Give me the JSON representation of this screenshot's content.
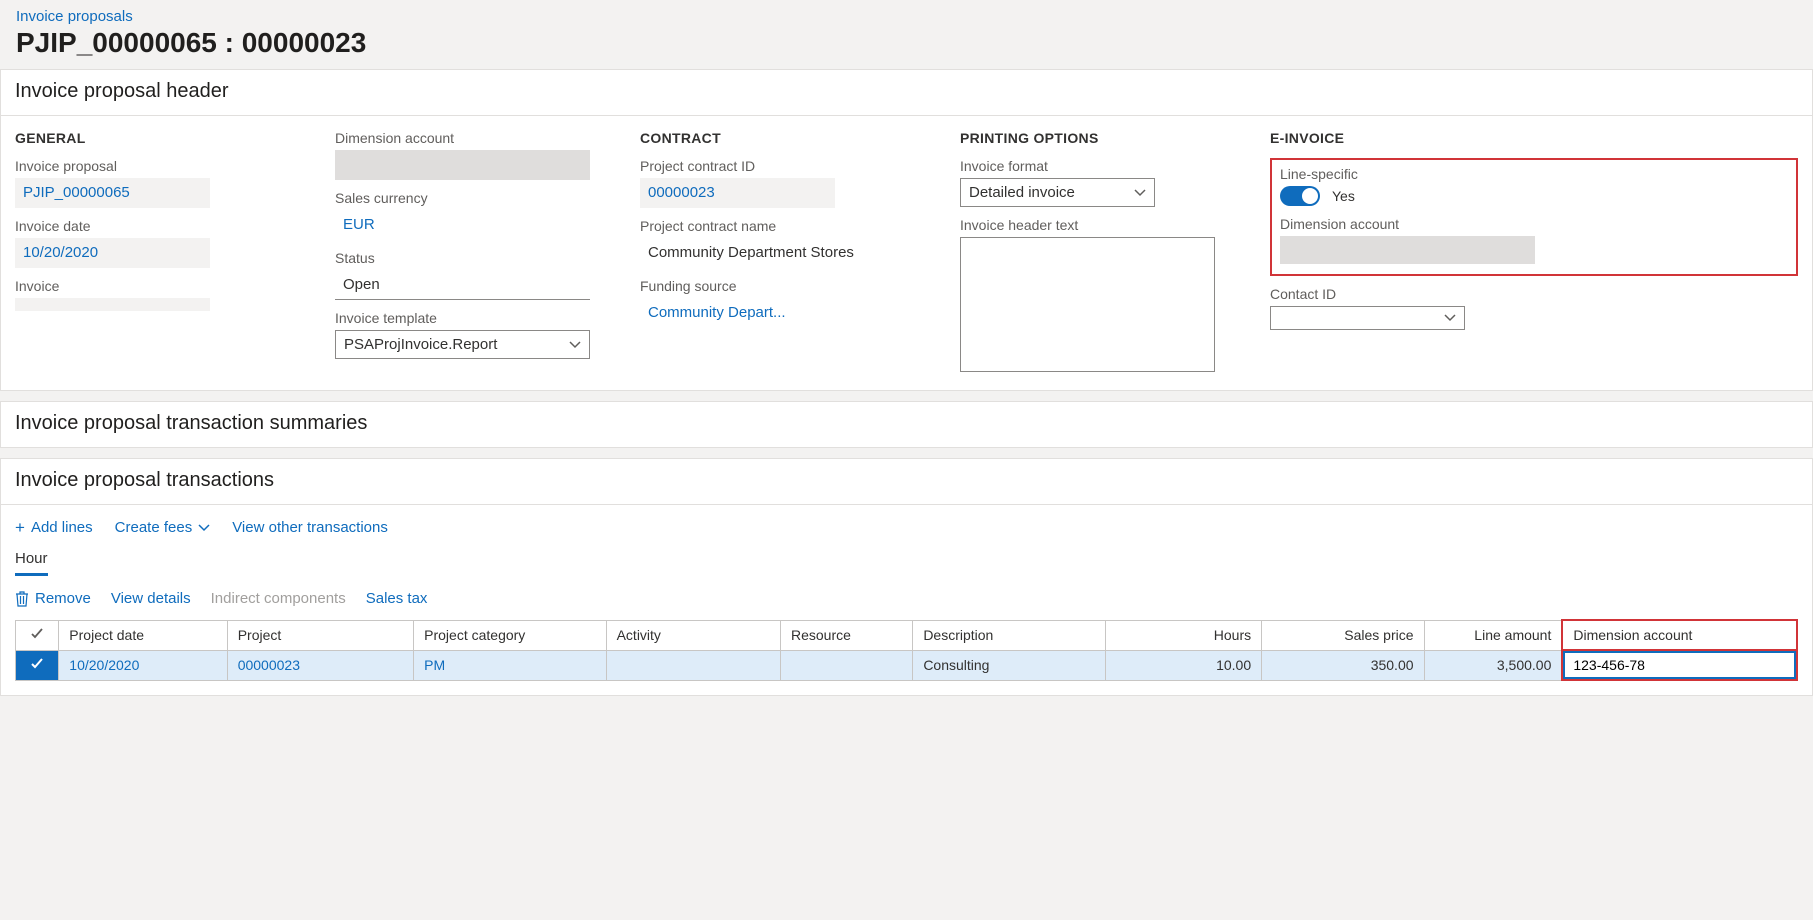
{
  "breadcrumb": "Invoice proposals",
  "page_title": "PJIP_00000065 : 00000023",
  "header": {
    "title": "Invoice proposal header",
    "general": {
      "label": "GENERAL",
      "invoice_proposal": {
        "label": "Invoice proposal",
        "value": "PJIP_00000065"
      },
      "invoice_date": {
        "label": "Invoice date",
        "value": "10/20/2020"
      },
      "invoice": {
        "label": "Invoice",
        "value": ""
      }
    },
    "dimension_account": {
      "label": "Dimension account"
    },
    "sales_currency": {
      "label": "Sales currency",
      "value": "EUR"
    },
    "status": {
      "label": "Status",
      "value": "Open"
    },
    "invoice_template": {
      "label": "Invoice template",
      "value": "PSAProjInvoice.Report"
    },
    "contract": {
      "label": "CONTRACT",
      "project_contract_id": {
        "label": "Project contract ID",
        "value": "00000023"
      },
      "project_contract_name": {
        "label": "Project contract name",
        "value": "Community Department Stores"
      },
      "funding_source": {
        "label": "Funding source",
        "value": "Community Depart..."
      }
    },
    "printing": {
      "label": "PRINTING OPTIONS",
      "invoice_format": {
        "label": "Invoice format",
        "value": "Detailed invoice"
      },
      "invoice_header_text": {
        "label": "Invoice header text"
      }
    },
    "einvoice": {
      "label": "E-INVOICE",
      "line_specific": {
        "label": "Line-specific",
        "value": "Yes"
      },
      "dimension_account": {
        "label": "Dimension account"
      },
      "contact_id": {
        "label": "Contact ID",
        "value": ""
      }
    }
  },
  "summaries": {
    "title": "Invoice proposal transaction summaries"
  },
  "transactions": {
    "title": "Invoice proposal transactions",
    "toolbar": {
      "add_lines": "Add lines",
      "create_fees": "Create fees",
      "view_other": "View other transactions"
    },
    "subtab": "Hour",
    "row_toolbar": {
      "remove": "Remove",
      "view_details": "View details",
      "indirect": "Indirect components",
      "sales_tax": "Sales tax"
    },
    "columns": {
      "project_date": "Project date",
      "project": "Project",
      "project_category": "Project category",
      "activity": "Activity",
      "resource": "Resource",
      "description": "Description",
      "hours": "Hours",
      "sales_price": "Sales price",
      "line_amount": "Line amount",
      "dimension_account": "Dimension account"
    },
    "rows": [
      {
        "project_date": "10/20/2020",
        "project": "00000023",
        "project_category": "PM",
        "activity": "",
        "resource": "",
        "description": "Consulting",
        "hours": "10.00",
        "sales_price": "350.00",
        "line_amount": "3,500.00",
        "dimension_account": "123-456-78"
      }
    ]
  }
}
